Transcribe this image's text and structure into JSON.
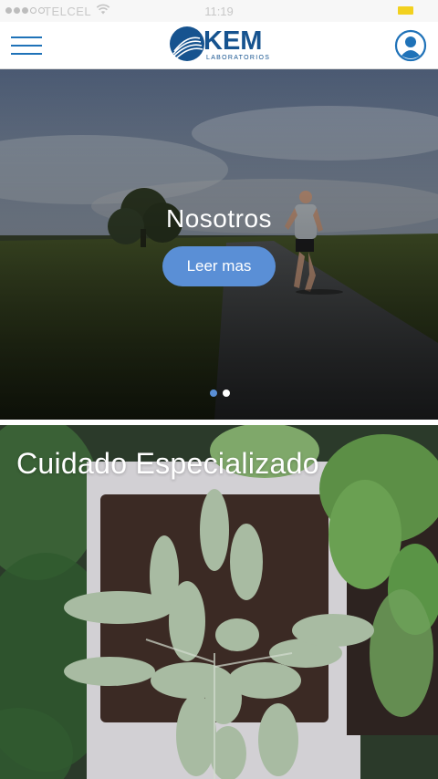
{
  "status_bar": {
    "carrier": "TELCEL",
    "time": "11:19"
  },
  "header": {
    "logo_text": "KEM",
    "logo_subtext": "LABORATORIOS"
  },
  "hero": {
    "title": "Nosotros",
    "button_label": "Leer mas",
    "slide_count": 2,
    "active_slide": 1
  },
  "card": {
    "title": "Cuidado Especializado"
  },
  "colors": {
    "brand_blue": "#16538f",
    "accent_blue": "#5a8fd6",
    "menu_blue": "#1f72b8"
  }
}
